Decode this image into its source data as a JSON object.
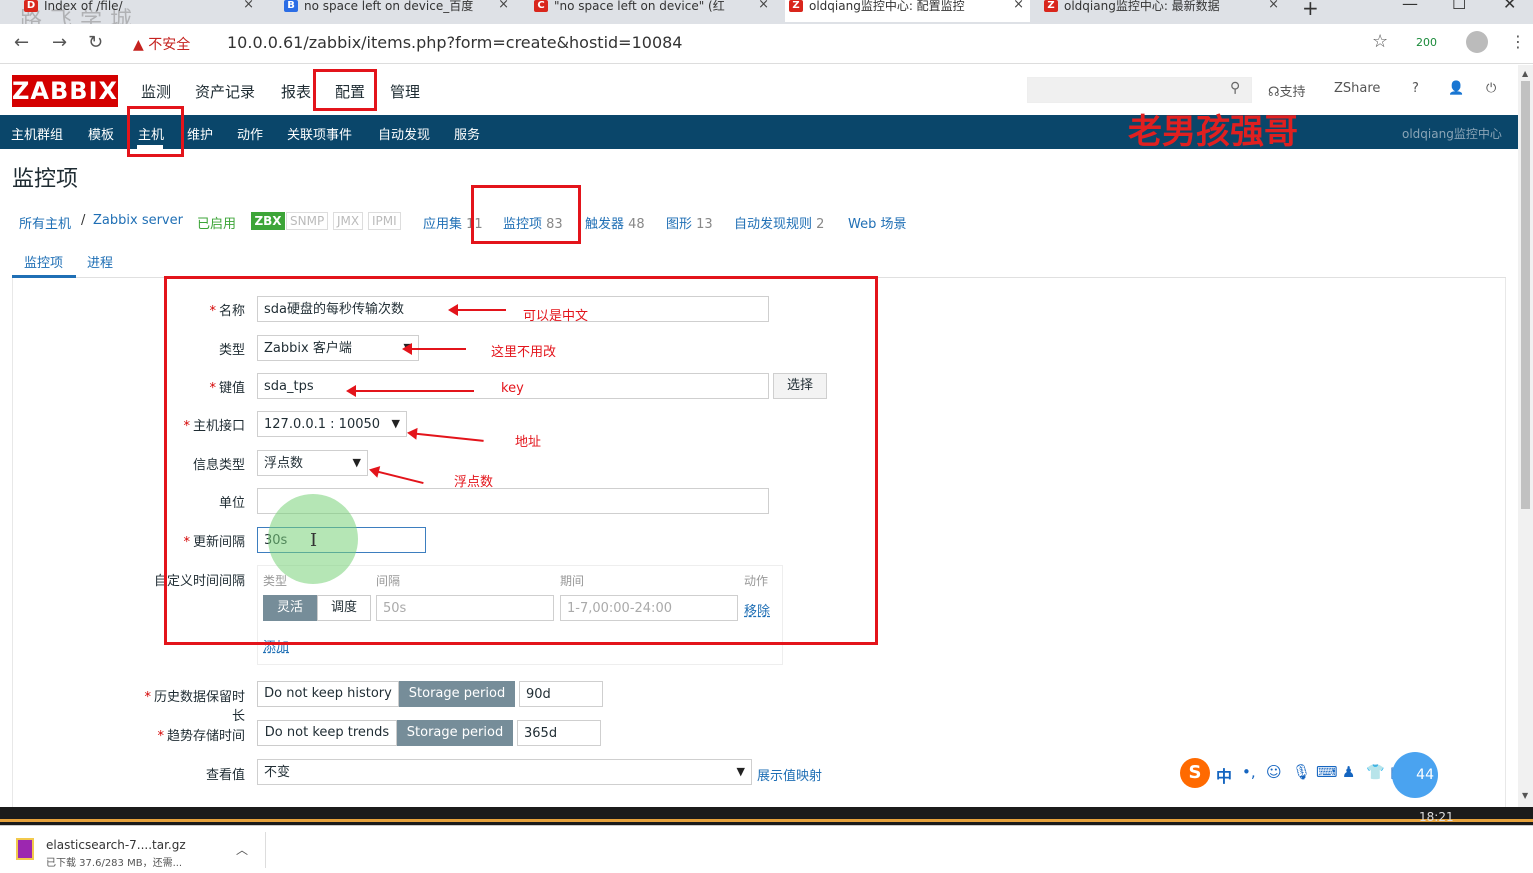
{
  "browser": {
    "tabs": [
      {
        "label": "Index of /file/",
        "active": false
      },
      {
        "label": "no space left on device_百度",
        "active": false
      },
      {
        "label": "\"no space left on device\" (红",
        "active": false
      },
      {
        "label": "oldqiang监控中心: 配置监控",
        "active": true
      },
      {
        "label": "oldqiang监控中心: 最新数据",
        "active": false
      }
    ],
    "tab_close": "×",
    "new_tab": "+",
    "security_label": "不安全",
    "url": "10.0.0.61/zabbix/items.php?form=create&hostid=10084",
    "extension_badge": "200",
    "ghost_text": "路飞学城"
  },
  "zabbix": {
    "logo": "ZABBIX",
    "top_menu": [
      "监测",
      "资产记录",
      "报表",
      "配置",
      "管理"
    ],
    "header_links": {
      "support": "支持",
      "share": "Share",
      "help": "?"
    },
    "sub_menu": [
      "主机群组",
      "模板",
      "主机",
      "维护",
      "动作",
      "关联项事件",
      "自动发现",
      "服务"
    ],
    "brand_right": "oldqiang监控中心",
    "watermark": "老男孩强哥",
    "page_title": "监控项",
    "breadcrumb": {
      "all_hosts": "所有主机",
      "sep": "/",
      "host": "Zabbix server",
      "enabled": "已启用",
      "zbx": "ZBX",
      "snmp": "SNMP",
      "jmx": "JMX",
      "ipmi": "IPMI"
    },
    "host_tabs": [
      {
        "label": "应用集",
        "count": "11"
      },
      {
        "label": "监控项",
        "count": "83"
      },
      {
        "label": "触发器",
        "count": "48"
      },
      {
        "label": "图形",
        "count": "13"
      },
      {
        "label": "自动发现规则",
        "count": "2"
      },
      {
        "label": "Web 场景",
        "count": ""
      }
    ],
    "form_tabs": [
      "监控项",
      "进程"
    ],
    "form": {
      "name_label": "名称",
      "name_value": "sda硬盘的每秒传输次数",
      "type_label": "类型",
      "type_value": "Zabbix 客户端",
      "key_label": "键值",
      "key_value": "sda_tps",
      "key_select": "选择",
      "interface_label": "主机接口",
      "interface_value": "127.0.0.1 : 10050",
      "info_type_label": "信息类型",
      "info_type_value": "浮点数",
      "unit_label": "单位",
      "unit_value": "",
      "interval_label": "更新间隔",
      "interval_value": "30s",
      "custom_label": "自定义时间间隔",
      "custom_headers": [
        "类型",
        "间隔",
        "期间",
        "动作"
      ],
      "custom_flexible": "灵活",
      "custom_scheduling": "调度",
      "custom_interval_ph": "50s",
      "custom_period_ph": "1-7,00:00-24:00",
      "custom_remove": "移除",
      "custom_add": "添加",
      "history_label": "历史数据保留时长",
      "history_no": "Do not keep history",
      "history_storage": "Storage period",
      "history_value": "90d",
      "trends_label": "趋势存储时间",
      "trends_no": "Do not keep trends",
      "trends_storage": "Storage period",
      "trends_value": "365d",
      "valuemap_label": "查看值",
      "valuemap_value": "不变",
      "valuemap_link": "展示值映射"
    }
  },
  "annotations": {
    "name": "可以是中文",
    "type": "这里不用改",
    "key": "key",
    "interface": "地址",
    "info_type": "浮点数"
  },
  "ime": {
    "logo": "S",
    "lang": "中",
    "badge": "44"
  },
  "taskbar": {
    "clock": "18:21"
  },
  "download": {
    "filename": "elasticsearch-7....tar.gz",
    "status": "已下载 37.6/283 MB，还需..."
  }
}
